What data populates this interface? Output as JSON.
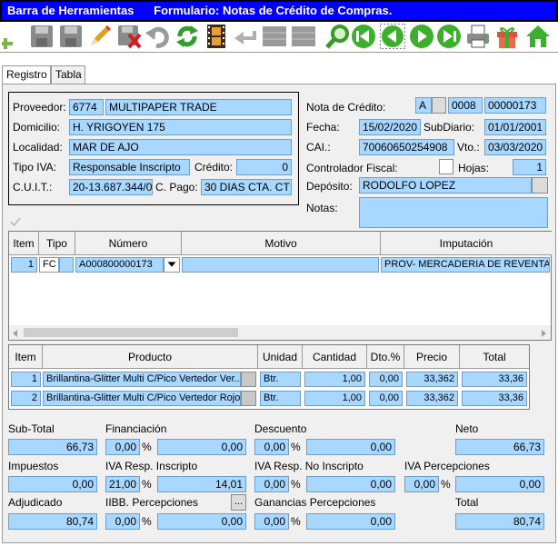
{
  "window": {
    "title": "Barra de Herramientas      Formulario: Notas de Crédito de Compras."
  },
  "toolbar": {
    "icons": [
      "add-icon",
      "save-icon",
      "save-disabled-icon",
      "edit-pencil-icon",
      "delete-icon",
      "undo-icon",
      "refresh-icon",
      "film-icon",
      "back-arrow-icon",
      "grid-icon",
      "grid-icon",
      "search-icon",
      "first-record-icon",
      "previous-record-icon",
      "next-record-icon",
      "last-record-icon",
      "print-icon",
      "gift-icon",
      "home-icon"
    ]
  },
  "tabs": [
    {
      "label": "Registro"
    },
    {
      "label": "Tabla"
    }
  ],
  "header": {
    "proveedor_label": "Proveedor:",
    "proveedor_code": "6774",
    "proveedor_name": "MULTIPAPER TRADE",
    "domicilio_label": "Domicilio:",
    "domicilio": "H. YRIGOYEN 175",
    "localidad_label": "Localidad:",
    "localidad": "MAR DE AJO",
    "tipo_iva_label": "Tipo IVA:",
    "tipo_iva": "Responsable Inscripto",
    "credito_label": "Crédito:",
    "credito": "0",
    "cuit_label": "C.U.I.T.:",
    "cuit": "20-13.687.344/0",
    "cpago_label": "C. Pago:",
    "cpago": "30 DIAS CTA. CT",
    "nota_label": "Nota de Crédito:",
    "nota_letra": "A",
    "nota_pv": "0008",
    "nota_numero": "00000173",
    "fecha_label": "Fecha:",
    "fecha": "15/02/2020",
    "subdiario_label": "SubDiario:",
    "subdiario": "01/01/2001",
    "cai_label": "CAI.:",
    "cai": "70060650254908",
    "vto_label": "Vto.:",
    "vto": "03/03/2020",
    "controlador_label": "Controlador Fiscal:",
    "hojas_label": "Hojas:",
    "hojas": "1",
    "deposito_label": "Depósito:",
    "deposito": "RODOLFO LOPEZ",
    "notas_label": "Notas:",
    "notas": ""
  },
  "imputacion_grid": {
    "columns": [
      "Item",
      "Tipo",
      "Número",
      "Motivo",
      "Imputación"
    ],
    "rows": [
      {
        "item": "1",
        "tipo": "FC",
        "numero": "A000800000173",
        "motivo": "",
        "imputacion": "PROV- MERCADERIA DE REVENTA"
      }
    ]
  },
  "producto_grid": {
    "columns": [
      "Item",
      "Producto",
      "Unidad",
      "Cantidad",
      "Dto.%",
      "Precio",
      "Total"
    ],
    "rows": [
      {
        "item": "1",
        "producto": "Brillantina-Glitter Multi C/Pico Vertedor Ver...",
        "unidad": "Btr.",
        "cantidad": "1,00",
        "dto": "0,00",
        "precio": "33,362",
        "total": "33,36"
      },
      {
        "item": "2",
        "producto": "Brillantina-Glitter Multi C/Pico Vertedor Rojo",
        "unidad": "Btr.",
        "cantidad": "1,00",
        "dto": "0,00",
        "precio": "33,362",
        "total": "33,36"
      }
    ]
  },
  "totals": {
    "subtotal_label": "Sub-Total",
    "subtotal": "66,73",
    "financiacion_label": "Financiación",
    "financiacion_pct": "0,00",
    "financiacion": "0,00",
    "descuento_label": "Descuento",
    "descuento_pct": "0,00",
    "descuento": "0,00",
    "neto_label": "Neto",
    "neto": "66,73",
    "impuestos_label": "Impuestos",
    "impuestos": "0,00",
    "iva_ri_label": "IVA Resp. Inscripto",
    "iva_ri_pct": "21,00",
    "iva_ri": "14,01",
    "iva_rni_label": "IVA Resp. No Inscripto",
    "iva_rni_pct": "0,00",
    "iva_rni": "0,00",
    "iva_perc_label": "IVA Percepciones",
    "iva_perc_pct": "0,00",
    "iva_perc": "0,00",
    "adjudicado_label": "Adjudicado",
    "adjudicado": "80,74",
    "iibb_label": "IIBB. Percepciones",
    "iibb_btn": "...",
    "iibb_pct": "0,00",
    "iibb": "0,00",
    "ganancias_label": "Ganancias Percepciones",
    "ganancias_pct": "0,00",
    "ganancias": "0,00",
    "total_label": "Total",
    "total": "80,74",
    "pct_sign": "%"
  }
}
